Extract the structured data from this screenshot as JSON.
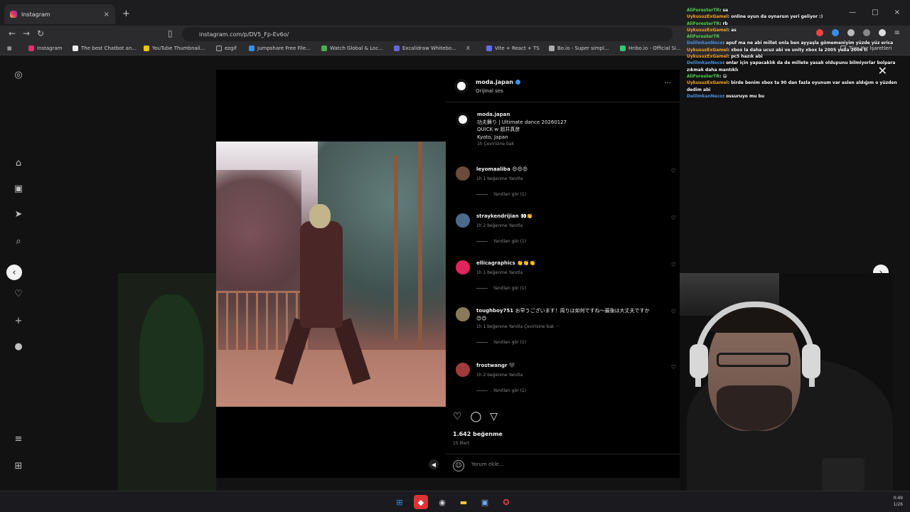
{
  "browser": {
    "tab_title": "Instagram",
    "url": "instagram.com/p/DV5_Fp-Ev6o/",
    "bookmarks": [
      "Instagram",
      "The best Chatbot an...",
      "YouTube Thumbnail...",
      "ezgif",
      "Jumpshare Free File...",
      "Watch Global & Loc...",
      "Excalidraw Whitebo...",
      "X",
      "Vite + React + TS",
      "Bo.io - Super simpl...",
      "Hribo.io - Official Si...",
      "Tüm Yer İşaretleri"
    ]
  },
  "post": {
    "header_user": "moda.japan",
    "header_sub": "Orijinal ses",
    "caption_user": "moda.japan",
    "caption_lines": [
      "功夫舞り | Ultimate dance 20260127",
      "QUICK w 超井真彦",
      "Kyoto, Japan"
    ],
    "caption_meta": "1h   Çevirisine bak",
    "likes": "1.642 beğenme",
    "date": "15 Mart",
    "comment_placeholder": "Yorum ekle..."
  },
  "comments": [
    {
      "user": "leyomaaliba",
      "text": "😍😍😍",
      "meta": "1h   1 beğenme   Yanıtla",
      "replies": "Yanıtları gör (1)",
      "avatar_color": "#6b4b3b"
    },
    {
      "user": "straykendrijian",
      "text": "👀👏",
      "meta": "1h   2 beğenme   Yanıtla",
      "replies": "Yanıtları gör (1)",
      "avatar_color": "#4a6a8a"
    },
    {
      "user": "ellicagraphics",
      "text": "👏👏👏",
      "meta": "1h   1 beğenme   Yanıtla",
      "replies": "Yanıtları gör (1)",
      "avatar_color": "#e0245e"
    },
    {
      "user": "toughboy751",
      "text": "お早うございます！周りは如何ですね～最後は大丈夫ですか😊😊",
      "meta": "1h   1 beğenme   Yanıtla   Çevirisine bak   ···",
      "replies": "Yanıtları gör (1)",
      "avatar_color": "#8a7a5a"
    },
    {
      "user": "frostwangr",
      "text": "🖤",
      "meta": "1h   2 beğenme   Yanıtla",
      "replies": "Yanıtları gör (1)",
      "avatar_color": "#a33a3a"
    }
  ],
  "chat": [
    {
      "name": "AliForesterTR",
      "msg": "sa",
      "color": "#4fd14f"
    },
    {
      "name": "UykusuzExGamel",
      "msg": "online oyun da oynarsın yeri geliyor :)",
      "color": "#f5a623"
    },
    {
      "name": "AliForesterTR",
      "msg": "rb",
      "color": "#4fd14f"
    },
    {
      "name": "UykusuzExGamel",
      "msg": "as",
      "color": "#f5a623"
    },
    {
      "name": "AliForesterTR",
      "msg": "",
      "color": "#4fd14f"
    },
    {
      "name": "DelilmkanNeco",
      "msg": "apuf ma ne abi millet onla ben ayyaşla gömemeniyim yüzde yüz erica",
      "color": "#4a90e2"
    },
    {
      "name": "UykusuzExGamel",
      "msg": "xbox la daha ucuz abi ve unity xbox la 2005 yolla 2006 tl",
      "color": "#f5a623"
    },
    {
      "name": "UykusuzExGamel",
      "msg": "pc5 hazık abi",
      "color": "#f5a623"
    },
    {
      "name": "DelilmkanNeco",
      "msg": "onlar için yapacaklık da de millete yasak oldupunu bilmiyorlar bolpara zıkmak daha mantıklı",
      "color": "#4a90e2"
    },
    {
      "name": "AliForesterTR",
      "msg": "😄",
      "color": "#4fd14f"
    },
    {
      "name": "UykusuzExGamel",
      "msg": "birde benim xbox ta 90 dan fazla oyunum var aslen aldığım o yüzden dedim abi",
      "color": "#f5a623"
    },
    {
      "name": "DelilmkanNeco",
      "msg": "ossuruyo mu bu",
      "color": "#4a90e2"
    }
  ],
  "taskbar": {
    "clock_time": "0:49",
    "clock_date": "1/26"
  },
  "icons": {
    "close": "close-icon",
    "more": "more-icon",
    "heart": "heart-icon",
    "comment": "comment-icon",
    "share": "share-icon",
    "mute": "mute-icon"
  }
}
